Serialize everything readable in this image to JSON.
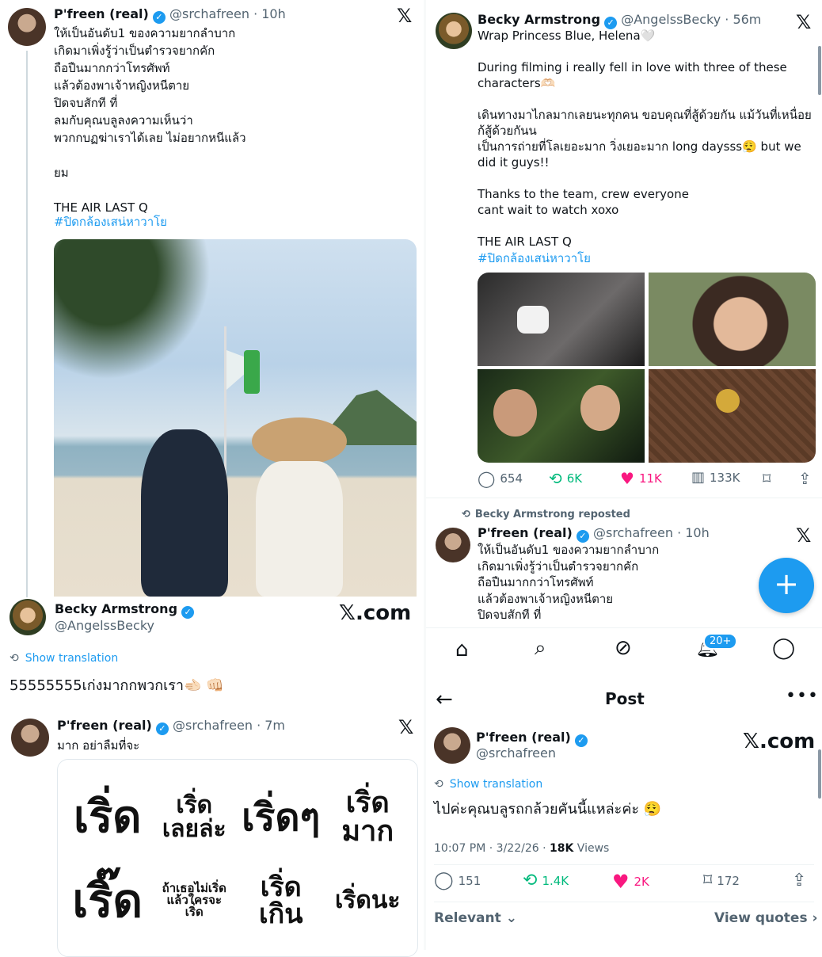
{
  "t1": {
    "name": "P'freen (real)",
    "handle": "@srchafreen · 10h",
    "lines": [
      "ให้เป็นอันดับ1 ของความยากลำบาก",
      "เกิดมาเพิ่งรู้ว่าเป็นตำรวจยากคัก",
      "ถือปืนมากกว่าโทรศัพท์",
      "แล้วต้องพาเจ้าหญิงหนีตาย",
      "ปิดจบสักที ที่",
      "ลมกับคุณบลูลงความเห็นว่า",
      "พวกกบฏฆ่าเราได้เลย ไม่อยากหนีแล้ว",
      "",
      "ยม",
      "",
      "THE AIR LAST Q"
    ],
    "hashtag": "#ปิดกล้องเสน่หาวาโย"
  },
  "r1": {
    "name": "Becky Armstrong",
    "handle": "@AngelssBecky",
    "site": "𝕏.com",
    "translate": "Show translation",
    "text": "55555555เก่งมากกพวกเรา🫲🏻 👊🏻"
  },
  "t2": {
    "name": "P'freen (real)",
    "handle": "@srchafreen · 7m",
    "text": "มาก อย่าลืมที่จะ",
    "stickers": [
      "เริ่ด",
      "เริ่ด\nเลยล่ะ",
      "เริ่ดๆ",
      "เริ่ด\nมาก",
      "เริ๊ด",
      "ถ้าเธอไม่เริ่ด\nแล้วใครจะ\nเริ่ด",
      "เริ่ด\nเกิน",
      "เริ่ดนะ"
    ]
  },
  "t3": {
    "name": "Becky Armstrong",
    "handle": "@AngelssBecky · 56m",
    "lines": [
      "Wrap Princess Blue, Helena🤍",
      "",
      "During filming i really fell in love with three of these characters🫶🏻",
      "",
      "เดินทางมาไกลมากเลยนะทุกคน ขอบคุณที่สู้ด้วยกัน แม้วันที่เหนื่อยก้สู้ด้วยกันน",
      "เป็นการถ่ายที่โลเยอะมาก วิ่งเยอะมาก long daysss😮‍💨 but we did it guys!!",
      "",
      "Thanks to the team, crew everyone",
      "cant wait to watch xoxo",
      "",
      "THE AIR LAST Q"
    ],
    "hashtag": "#ปิดกล้องเสน่หาวาโย",
    "replies": "654",
    "reposts": "6K",
    "likes": "11K",
    "views": "133K"
  },
  "t4": {
    "repost_label": "Becky Armstrong reposted",
    "name": "P'freen (real)",
    "handle": "@srchafreen · 10h",
    "lines": [
      "ให้เป็นอันดับ1 ของความยากลำบาก",
      "เกิดมาเพิ่งรู้ว่าเป็นตำรวจยากคัก",
      "ถือปืนมากกว่าโทรศัพท์",
      "แล้วต้องพาเจ้าหญิงหนีตาย",
      "ปิดจบสักที ที่"
    ]
  },
  "nav": {
    "badge": "20+"
  },
  "post": {
    "title": "Post",
    "name": "P'freen (real)",
    "handle": "@srchafreen",
    "site": "𝕏.com",
    "translate": "Show translation",
    "text": "ไปค่ะคุณบลูรถกล้วยคันนี้แหล่ะค่ะ 😮‍💨",
    "meta_time": "10:07 PM · 3/22/26 · ",
    "meta_views": "18K",
    "meta_views_label": " Views",
    "replies": "151",
    "reposts": "1.4K",
    "likes": "2K",
    "bookmarks": "172",
    "relevant": "Relevant",
    "view_quotes": "View quotes"
  }
}
